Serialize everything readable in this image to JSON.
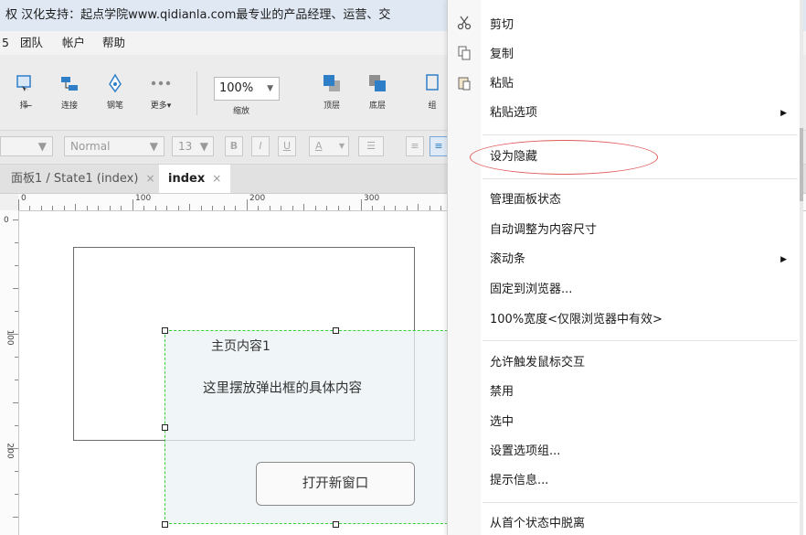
{
  "title": "权 汉化支持：起点学院www.qidianla.com最专业的产品经理、运营、交",
  "menu": {
    "left_fragment": "5",
    "team": "团队",
    "account": "帐户",
    "help": "帮助"
  },
  "toolbar": {
    "select_label": "择",
    "connect_label": "连接",
    "pen_label": "钢笔",
    "more_label": "更多▾",
    "zoom_value": "100%",
    "zoom_label": "缩放",
    "top_label": "顶层",
    "bottom_label": "底层",
    "group_label": "组"
  },
  "format": {
    "font_style": "Normal",
    "font_size": "13",
    "bold": "B",
    "italic": "I",
    "underline": "U",
    "color_a": "A"
  },
  "tabs": [
    {
      "label": "面板1 / State1 (index)",
      "close": "×"
    },
    {
      "label": "index",
      "close": "×"
    }
  ],
  "ruler": {
    "h": [
      "0",
      "100",
      "200",
      "300"
    ],
    "v": [
      "0",
      "100",
      "200"
    ]
  },
  "canvas": {
    "text_main": "主页内容1",
    "text_popup": "这里摆放弹出框的具体内容",
    "open_button": "打开新窗口"
  },
  "context_menu": {
    "items": [
      {
        "label": "剪切",
        "icon": "scissors-icon"
      },
      {
        "label": "复制",
        "icon": "copy-icon"
      },
      {
        "label": "粘贴",
        "icon": "paste-icon"
      },
      {
        "label": "粘贴选项",
        "submenu": true
      },
      {
        "label": "设为隐藏",
        "highlighted": true
      },
      {
        "label": "管理面板状态"
      },
      {
        "label": "自动调整为内容尺寸"
      },
      {
        "label": "滚动条",
        "submenu": true
      },
      {
        "label": "固定到浏览器..."
      },
      {
        "label": "100%宽度<仅限浏览器中有效>"
      },
      {
        "label": "允许触发鼠标交互"
      },
      {
        "label": "禁用"
      },
      {
        "label": "选中"
      },
      {
        "label": "设置选项组..."
      },
      {
        "label": "提示信息..."
      },
      {
        "label": "从首个状态中脱离"
      }
    ],
    "highlight_color": "#e05a5a"
  }
}
